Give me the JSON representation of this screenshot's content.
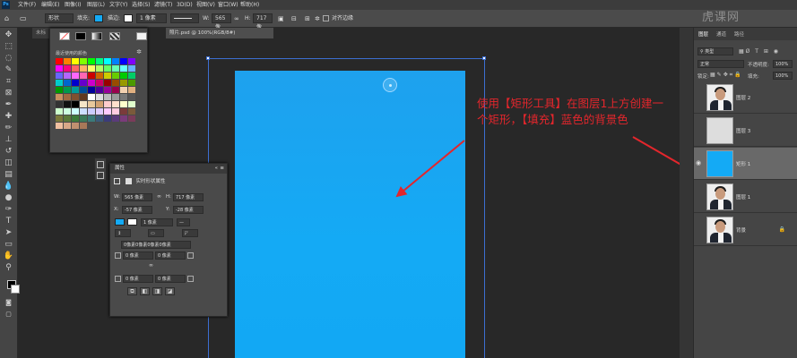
{
  "menubar": {
    "app_icon": "Ps",
    "items": [
      "文件(F)",
      "编辑(E)",
      "图像(I)",
      "图层(L)",
      "文字(Y)",
      "选择(S)",
      "滤镜(T)",
      "3D(D)",
      "视图(V)",
      "窗口(W)",
      "帮助(H)"
    ]
  },
  "options": {
    "shape_mode": "形状",
    "fill_label": "填充:",
    "stroke_label": "描边:",
    "stroke_width": "1 像素",
    "w_label": "W:",
    "w_value": "565 像",
    "h_label": "H:",
    "h_value": "717 像",
    "align_edges": "对齐边缘"
  },
  "doc_tabs": {
    "tab1": "未标",
    "tab2": "照片.psd @ 100%(RGB/8#)"
  },
  "swatches": {
    "recent_label": "最近使用的颜色",
    "colors": [
      "#ff0000",
      "#ff8000",
      "#ffff00",
      "#80ff00",
      "#00ff00",
      "#00ff80",
      "#00ffff",
      "#0080ff",
      "#0000ff",
      "#8000ff",
      "#ff00ff",
      "#ff0080",
      "#ff6666",
      "#ffb366",
      "#ffff66",
      "#b3ff66",
      "#66ff66",
      "#66ffb3",
      "#66ffff",
      "#66b3ff",
      "#6666ff",
      "#b366ff",
      "#ff66ff",
      "#ff66b3",
      "#cc0000",
      "#cc6600",
      "#cccc00",
      "#66cc00",
      "#00cc00",
      "#00cc66",
      "#00cccc",
      "#0066cc",
      "#0000cc",
      "#6600cc",
      "#cc00cc",
      "#cc0066",
      "#990000",
      "#994c00",
      "#999900",
      "#4c9900",
      "#009900",
      "#00994c",
      "#009999",
      "#004c99",
      "#000099",
      "#4c0099",
      "#990099",
      "#99004c",
      "#f2d0b0",
      "#e0b080",
      "#c89060",
      "#a06840",
      "#805030",
      "#603820",
      "#ffffff",
      "#dddddd",
      "#bbbbbb",
      "#999999",
      "#777777",
      "#555555",
      "#333333",
      "#111111",
      "#000000",
      "#f5e6c8",
      "#e8c89c",
      "#d0a070",
      "#ffcccc",
      "#ffe0cc",
      "#ffffcc",
      "#e0ffcc",
      "#ccffcc",
      "#ccffe0",
      "#ccffff",
      "#cce0ff",
      "#ccccff",
      "#e0ccff",
      "#ffccff",
      "#ffcce0",
      "#7a3b3b",
      "#7a5a3b",
      "#7a7a3b",
      "#5a7a3b",
      "#3b7a3b",
      "#3b7a5a",
      "#3b7a7a",
      "#3b5a7a",
      "#3b3b7a",
      "#5a3b7a",
      "#7a3b7a",
      "#7a3b5a",
      "#f0c0a0",
      "#d8a888",
      "#c09070",
      "#a87858"
    ]
  },
  "properties": {
    "title": "属性",
    "subtitle": "实时形状属性",
    "w_label": "W:",
    "w_value": "565 像素",
    "h_label": "H:",
    "h_value": "717 像素",
    "x_label": "X:",
    "x_value": "-57 像素",
    "y_label": "Y:",
    "y_value": "-28 像素",
    "stroke_value": "1 像素",
    "corners_all": "0像素0像素0像素0像素",
    "corner1": "0 像素",
    "corner2": "0 像素",
    "corner3": "0 像素",
    "corner4": "0 像素"
  },
  "annotation": {
    "text": "使用【矩形工具】在图层1上方创建一个矩形，【填充】蓝色的背景色",
    "color": "#e3262c"
  },
  "layers_panel": {
    "tabs": [
      "图层",
      "通道",
      "路径"
    ],
    "kind_label": "类型",
    "blend_mode": "正常",
    "opacity_label": "不透明度:",
    "opacity_value": "100%",
    "lock_label": "锁定:",
    "fill_label": "填充:",
    "fill_value": "100%",
    "layers": [
      {
        "name": "图层 2",
        "thumb": "person",
        "visible": false,
        "selected": false
      },
      {
        "name": "图层 3",
        "thumb": "transparent",
        "visible": false,
        "selected": false
      },
      {
        "name": "矩形 1",
        "thumb": "blue",
        "visible": true,
        "selected": true
      },
      {
        "name": "图层 1",
        "thumb": "person",
        "visible": false,
        "selected": false
      },
      {
        "name": "背景",
        "thumb": "person",
        "visible": false,
        "selected": false
      }
    ]
  },
  "watermark": "虎课网",
  "colors": {
    "canvas_blue": "#14aaf5",
    "accent": "#31a8ff"
  }
}
